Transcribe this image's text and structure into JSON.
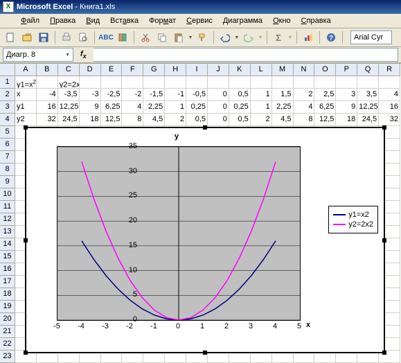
{
  "title_app": "Microsoft Excel",
  "title_doc": "Книга1.xls",
  "menu": {
    "file": "Файл",
    "edit": "Правка",
    "view": "Вид",
    "insert": "Вставка",
    "format": "Формат",
    "tools": "Сервис",
    "chart": "Диаграмма",
    "window": "Окно",
    "help": "Справка"
  },
  "font_name": "Arial Cyr",
  "namebox": "Диагр. 8",
  "fx_value": "",
  "columns": [
    "A",
    "B",
    "C",
    "D",
    "E",
    "F",
    "G",
    "H",
    "I",
    "J",
    "K",
    "L",
    "M",
    "N",
    "O",
    "P",
    "Q",
    "R"
  ],
  "rows_label": [
    "1",
    "2",
    "3",
    "4",
    "5",
    "6",
    "7",
    "8",
    "9",
    "10",
    "11",
    "12",
    "13",
    "14",
    "15",
    "16",
    "17",
    "18",
    "19",
    "20",
    "21",
    "22",
    "23"
  ],
  "row1": {
    "A": "y1=x",
    "C": "y2=2x"
  },
  "row2": {
    "A": "x",
    "B": "-4",
    "C": "-3,5",
    "D": "-3",
    "E": "-2,5",
    "F": "-2",
    "G": "-1,5",
    "H": "-1",
    "I": "-0,5",
    "J": "0",
    "K": "0,5",
    "L": "1",
    "M": "1,5",
    "N": "2",
    "O": "2,5",
    "P": "3",
    "Q": "3,5",
    "R": "4"
  },
  "row3": {
    "A": "y1",
    "B": "16",
    "C": "12,25",
    "D": "9",
    "E": "6,25",
    "F": "4",
    "G": "2,25",
    "H": "1",
    "I": "0,25",
    "J": "0",
    "K": "0,25",
    "L": "1",
    "M": "2,25",
    "N": "4",
    "O": "6,25",
    "P": "9",
    "Q": "12,25",
    "R": "16"
  },
  "row4": {
    "A": "y2",
    "B": "32",
    "C": "24,5",
    "D": "18",
    "E": "12,5",
    "F": "8",
    "G": "4,5",
    "H": "2",
    "I": "0,5",
    "J": "0",
    "K": "0,5",
    "L": "2",
    "M": "4,5",
    "N": "8",
    "O": "12,5",
    "P": "18",
    "Q": "24,5",
    "R": "32"
  },
  "chart": {
    "ytitle": "y",
    "xtitle": "x",
    "legend": [
      "y1=x2",
      "y2=2x2"
    ],
    "colors": {
      "y1": "#000080",
      "y2": "#ff00ff"
    },
    "yticks": [
      "35",
      "30",
      "25",
      "20",
      "15",
      "10",
      "5",
      "0"
    ],
    "xticks": [
      "-5",
      "-4",
      "-3",
      "-2",
      "-1",
      "0",
      "1",
      "2",
      "3",
      "4",
      "5"
    ]
  },
  "chart_data": {
    "type": "line",
    "title": "",
    "xlabel": "x",
    "ylabel": "y",
    "xlim": [
      -5,
      5
    ],
    "ylim": [
      0,
      35
    ],
    "x": [
      -4,
      -3.5,
      -3,
      -2.5,
      -2,
      -1.5,
      -1,
      -0.5,
      0,
      0.5,
      1,
      1.5,
      2,
      2.5,
      3,
      3.5,
      4
    ],
    "series": [
      {
        "name": "y1=x2",
        "values": [
          16,
          12.25,
          9,
          6.25,
          4,
          2.25,
          1,
          0.25,
          0,
          0.25,
          1,
          2.25,
          4,
          6.25,
          9,
          12.25,
          16
        ],
        "color": "#000080"
      },
      {
        "name": "y2=2x2",
        "values": [
          32,
          24.5,
          18,
          12.5,
          8,
          4.5,
          2,
          0.5,
          0,
          0.5,
          2,
          4.5,
          8,
          12.5,
          18,
          24.5,
          32
        ],
        "color": "#ff00ff"
      }
    ]
  }
}
